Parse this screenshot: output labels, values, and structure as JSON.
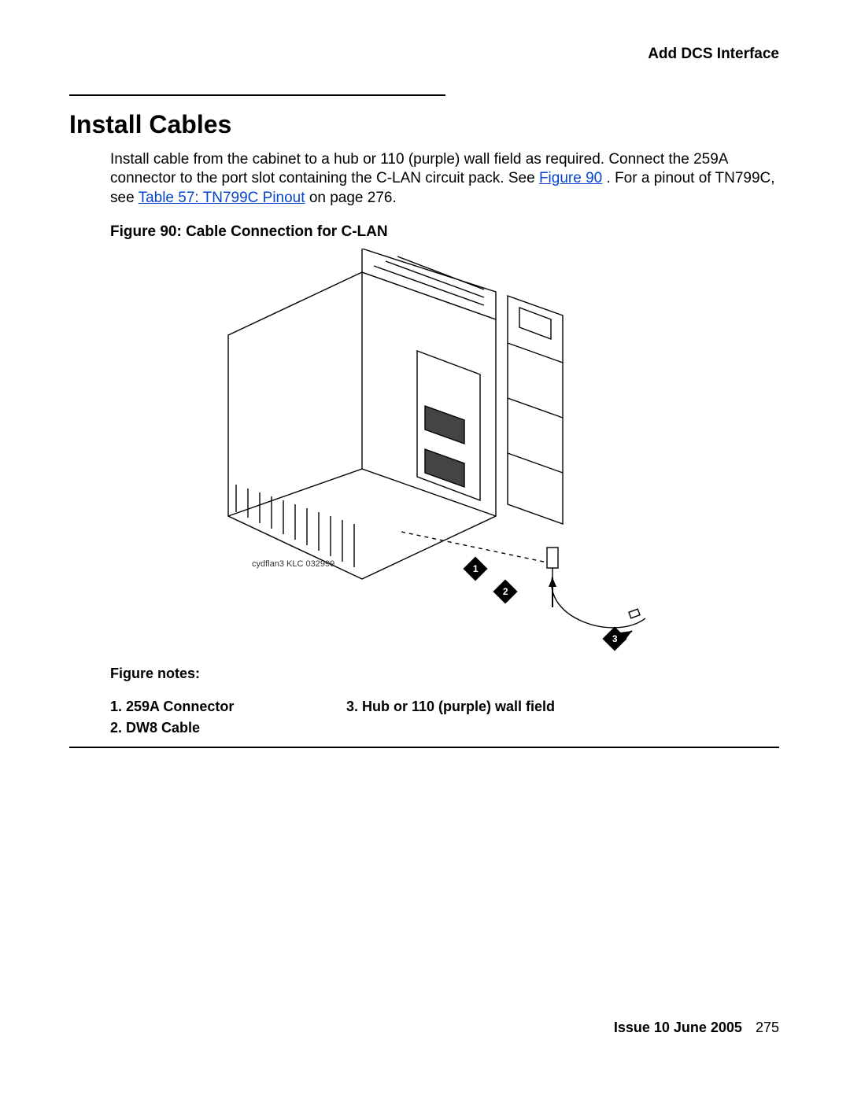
{
  "header": {
    "right_label": "Add DCS Interface"
  },
  "section": {
    "title": "Install Cables",
    "paragraph_parts": {
      "p1a": "Install cable from the cabinet to a hub or 110 (purple) wall field as required. Connect the 259A connector to the port slot containing the C-LAN circuit pack. See ",
      "link1": "Figure 90",
      "p1b": ". For a pinout of TN799C, see ",
      "link2": "Table 57:  TN799C Pinout",
      "p1c": " on page 276."
    }
  },
  "figure": {
    "caption": "Figure 90: Cable Connection for C-LAN",
    "image_credit": "cydflan3  KLC 032999",
    "callouts": {
      "1": "1",
      "2": "2",
      "3": "3"
    },
    "notes_label": "Figure notes:",
    "notes": {
      "n1": "1.  259A Connector",
      "n2": "2.  DW8 Cable",
      "n3": "3.   Hub or 110 (purple) wall field"
    }
  },
  "footer": {
    "issue": "Issue 10    June 2005",
    "page": "275"
  }
}
